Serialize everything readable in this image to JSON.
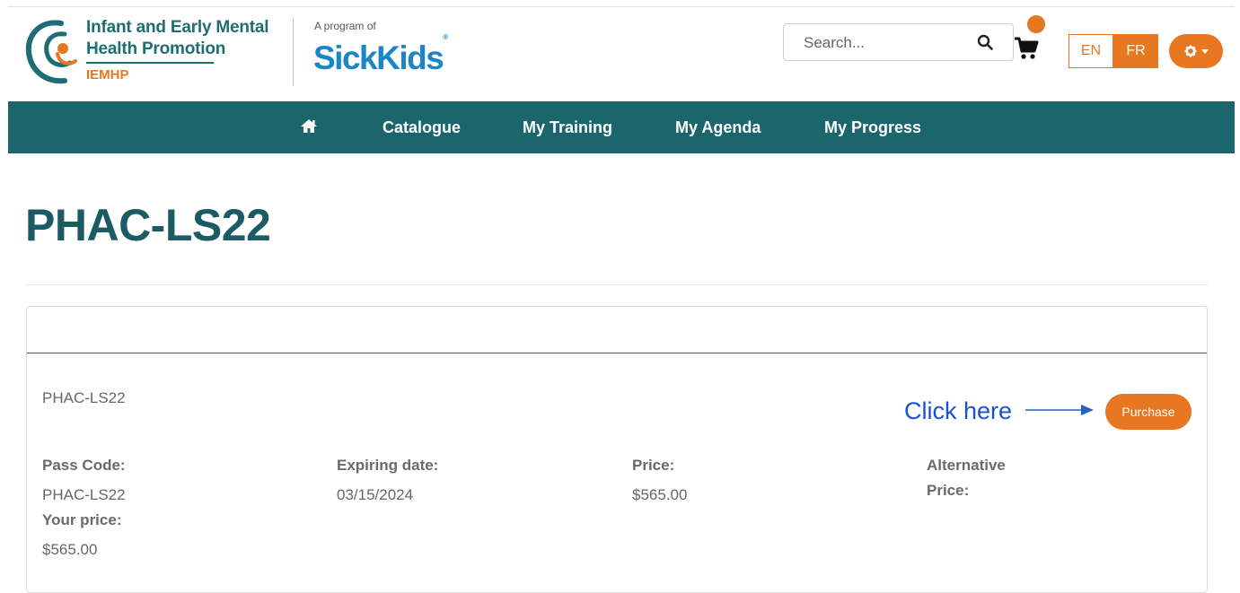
{
  "brand": {
    "line1": "Infant and Early Mental",
    "line2": "Health Promotion",
    "acronym": "IEMHP",
    "program_of": "A program of",
    "partner": "SickKids",
    "partner_mark": "®",
    "colors": {
      "teal": "#1b656c",
      "orange": "#e87722",
      "blue": "#1a86c8"
    }
  },
  "header": {
    "search_placeholder": "Search...",
    "search_icon": "search-icon",
    "cart_icon": "cart-icon",
    "languages": [
      "EN",
      "FR"
    ],
    "active_language": "FR",
    "settings_icon": "gear-icon"
  },
  "nav": {
    "home_icon": "home-icon",
    "items": [
      {
        "label": "Catalogue"
      },
      {
        "label": "My Training"
      },
      {
        "label": "My Agenda"
      },
      {
        "label": "My Progress"
      }
    ]
  },
  "page": {
    "title": "PHAC-LS22"
  },
  "card": {
    "code": "PHAC-LS22",
    "purchase_label": "Purchase",
    "annotation": "Click here",
    "fields": {
      "pass_code": {
        "label": "Pass Code:",
        "value": "PHAC-LS22"
      },
      "expiring": {
        "label": "Expiring date:",
        "value": "03/15/2024"
      },
      "price": {
        "label": "Price:",
        "value": "$565.00"
      },
      "alternative_line1": "Alternative",
      "alternative_line2": "Price:",
      "your_price": {
        "label": "Your price:",
        "value": "$565.00"
      }
    }
  }
}
